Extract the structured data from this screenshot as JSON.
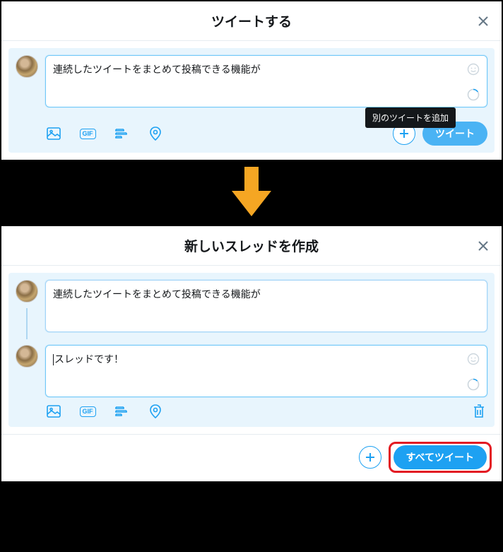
{
  "dialog1": {
    "title": "ツイートする",
    "tweet_text": "連続したツイートをまとめて投稿できる機能が",
    "tooltip": "別のツイートを追加",
    "tweet_button": "ツイート"
  },
  "dialog2": {
    "title": "新しいスレッドを作成",
    "tweet1_text": "連続したツイートをまとめて投稿できる機能が",
    "tweet2_text": "スレッドです！",
    "tweet_all_button": "すべてツイート"
  },
  "icons": {
    "gif_label": "GIF"
  }
}
